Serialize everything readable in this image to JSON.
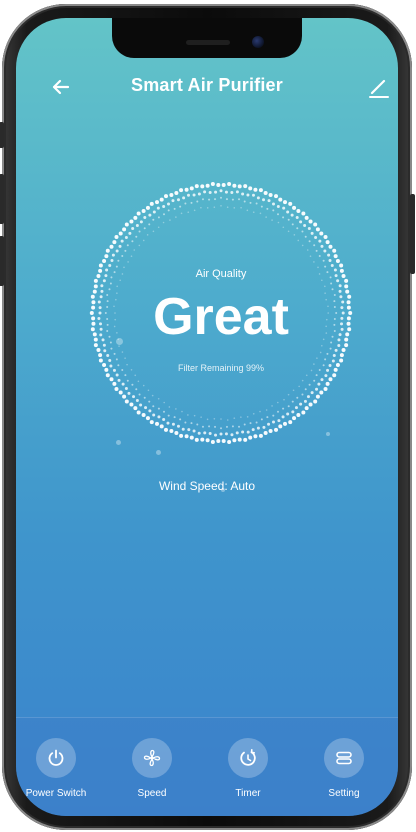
{
  "app": {
    "title": "Smart Air Purifier"
  },
  "status": {
    "air_quality_label": "Air Quality",
    "air_quality_value": "Great",
    "filter_text": "Filter Remaining 99%",
    "filter_remaining_percent": 99,
    "wind_speed_text": "Wind Speed: Auto"
  },
  "actions": [
    {
      "label": "Power Switch",
      "icon": "power-icon"
    },
    {
      "label": "Speed",
      "icon": "fan-icon"
    },
    {
      "label": "Timer",
      "icon": "timer-icon"
    },
    {
      "label": "Setting",
      "icon": "setting-icon"
    }
  ],
  "colors": {
    "background_top": "#63c4c8",
    "background_bottom": "#3a82cc",
    "text": "#ffffff"
  }
}
